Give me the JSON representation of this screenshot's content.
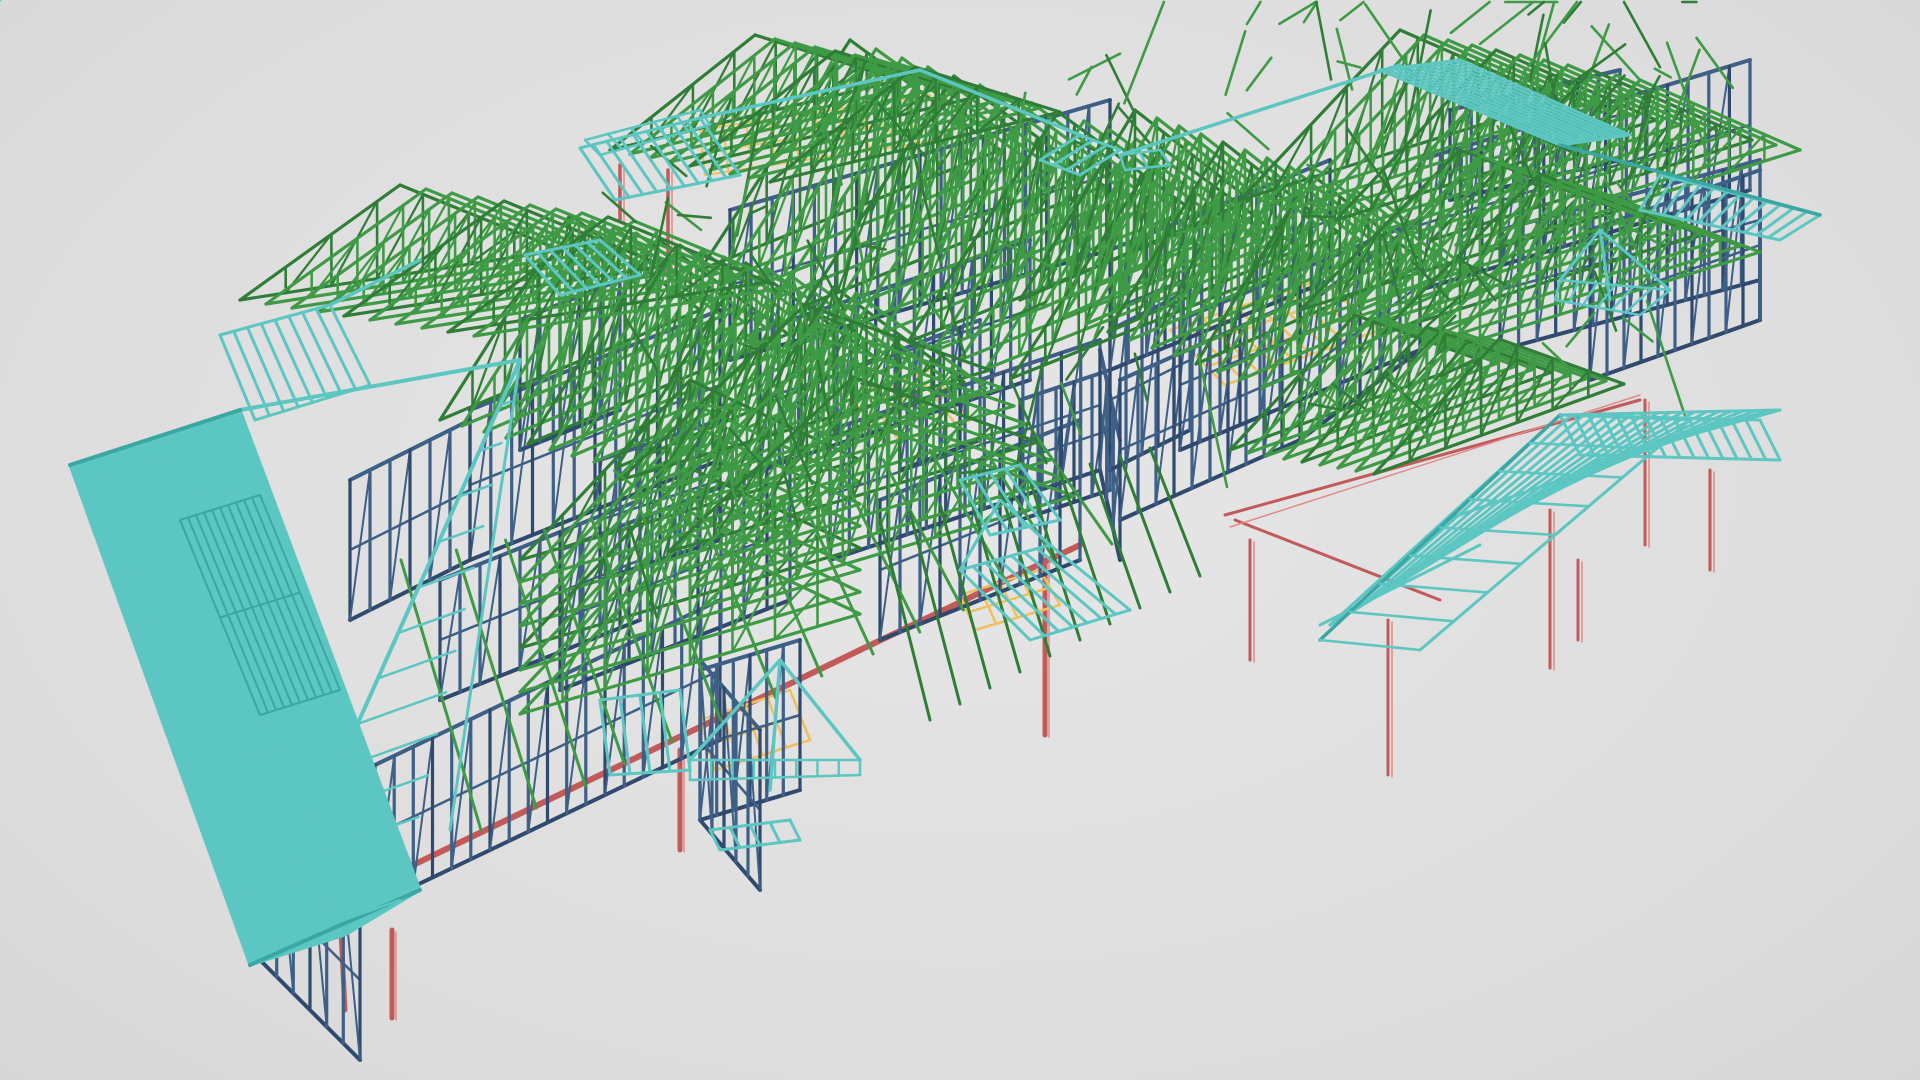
{
  "scene": {
    "background": "#e1e1e1",
    "colors": {
      "wall_frame": "#3e5f86",
      "wall_frame_dark": "#2f4a6e",
      "roof_truss": "#3f9a45",
      "roof_truss_dark": "#2f7d36",
      "hip_rafter": "#5cc6c2",
      "hip_rafter_dark": "#3aa7a3",
      "post_beam": "#c25a5a",
      "ceiling_joist": "#f0c060"
    },
    "members": {
      "wall_frame": "wall-frames",
      "roof_truss": "roof-trusses",
      "hip_rafter": "hip-rafters",
      "post_beam": "posts-and-beams",
      "ceiling_joist": "ceiling-joists"
    }
  }
}
